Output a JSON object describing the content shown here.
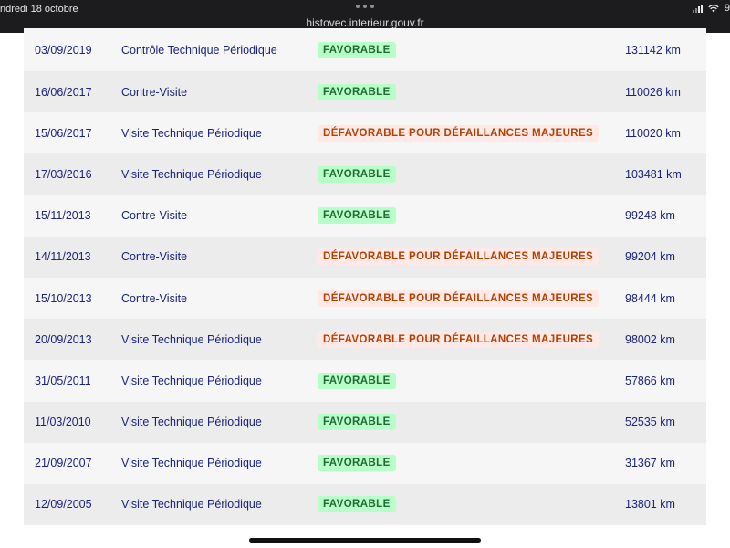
{
  "status_bar": {
    "date": "ndredi 18 octobre",
    "url": "histovec.interieur.gouv.fr",
    "battery": "9"
  },
  "colors": {
    "favorable_bg": "#b8fec9",
    "favorable_text": "#1e6b35",
    "defavorable_bg": "#ffe9e6",
    "defavorable_text": "#b34000",
    "row_text": "#1a237e"
  },
  "rows": [
    {
      "date": "03/09/2019",
      "type": "Contrôle Technique Périodique",
      "result": "FAVORABLE",
      "status": "ok",
      "km": "131142 km"
    },
    {
      "date": "16/06/2017",
      "type": "Contre-Visite",
      "result": "FAVORABLE",
      "status": "ok",
      "km": "110026 km"
    },
    {
      "date": "15/06/2017",
      "type": "Visite Technique Périodique",
      "result": "DÉFAVORABLE POUR DÉFAILLANCES MAJEURES",
      "status": "ko",
      "km": "110020 km"
    },
    {
      "date": "17/03/2016",
      "type": "Visite Technique Périodique",
      "result": "FAVORABLE",
      "status": "ok",
      "km": "103481 km"
    },
    {
      "date": "15/11/2013",
      "type": "Contre-Visite",
      "result": "FAVORABLE",
      "status": "ok",
      "km": "99248 km"
    },
    {
      "date": "14/11/2013",
      "type": "Contre-Visite",
      "result": "DÉFAVORABLE POUR DÉFAILLANCES MAJEURES",
      "status": "ko",
      "km": "99204 km"
    },
    {
      "date": "15/10/2013",
      "type": "Contre-Visite",
      "result": "DÉFAVORABLE POUR DÉFAILLANCES MAJEURES",
      "status": "ko",
      "km": "98444 km"
    },
    {
      "date": "20/09/2013",
      "type": "Visite Technique Périodique",
      "result": "DÉFAVORABLE POUR DÉFAILLANCES MAJEURES",
      "status": "ko",
      "km": "98002 km"
    },
    {
      "date": "31/05/2011",
      "type": "Visite Technique Périodique",
      "result": "FAVORABLE",
      "status": "ok",
      "km": "57866 km"
    },
    {
      "date": "11/03/2010",
      "type": "Visite Technique Périodique",
      "result": "FAVORABLE",
      "status": "ok",
      "km": "52535 km"
    },
    {
      "date": "21/09/2007",
      "type": "Visite Technique Périodique",
      "result": "FAVORABLE",
      "status": "ok",
      "km": "31367 km"
    },
    {
      "date": "12/09/2005",
      "type": "Visite Technique Périodique",
      "result": "FAVORABLE",
      "status": "ok",
      "km": "13801 km"
    }
  ]
}
